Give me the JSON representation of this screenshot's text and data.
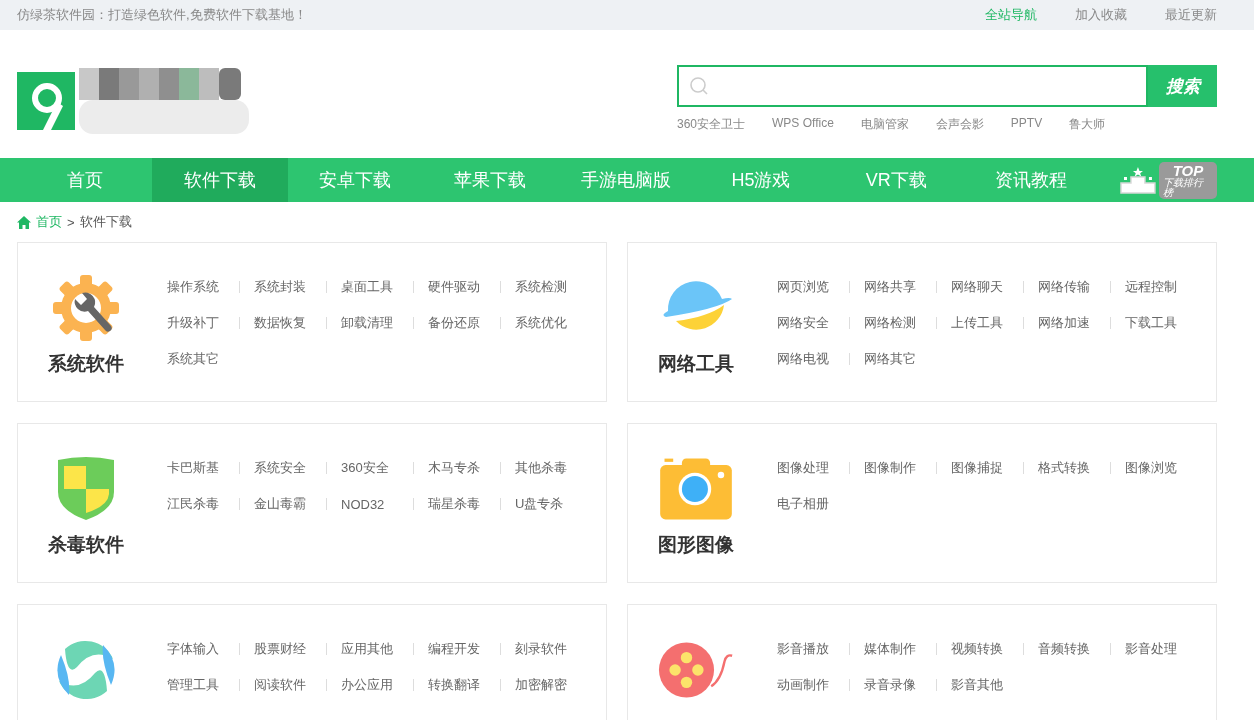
{
  "top_bar": {
    "slogan": "仿绿茶软件园：打造绿色软件,免费软件下载基地！",
    "links": [
      {
        "label": "全站导航",
        "highlighted": true
      },
      {
        "label": "加入收藏",
        "highlighted": false
      },
      {
        "label": "最近更新",
        "highlighted": false
      }
    ]
  },
  "search": {
    "button": "搜索",
    "hot_keywords": [
      "360安全卫士",
      "WPS Office",
      "电脑管家",
      "会声会影",
      "PPTV",
      "鲁大师"
    ]
  },
  "nav": {
    "items": [
      {
        "label": "首页",
        "selected": false
      },
      {
        "label": "软件下载",
        "selected": true
      },
      {
        "label": "安卓下载",
        "selected": false
      },
      {
        "label": "苹果下载",
        "selected": false
      },
      {
        "label": "手游电脑版",
        "selected": false
      },
      {
        "label": "H5游戏",
        "selected": false
      },
      {
        "label": "VR下载",
        "selected": false
      },
      {
        "label": "资讯教程",
        "selected": false
      }
    ],
    "ranking_badge": {
      "title": "TOP",
      "subtitle": "下载排行榜"
    }
  },
  "breadcrumb": {
    "home": "首页",
    "separator": ">",
    "current": "软件下载"
  },
  "categories": [
    {
      "title": "系统软件",
      "kind": "gear",
      "links": [
        "操作系统",
        "系统封装",
        "桌面工具",
        "硬件驱动",
        "系统检测",
        "升级补丁",
        "数据恢复",
        "卸载清理",
        "备份还原",
        "系统优化",
        "系统其它"
      ]
    },
    {
      "title": "网络工具",
      "kind": "planet",
      "links": [
        "网页浏览",
        "网络共享",
        "网络聊天",
        "网络传输",
        "远程控制",
        "网络安全",
        "网络检测",
        "上传工具",
        "网络加速",
        "下载工具",
        "网络电视",
        "网络其它"
      ]
    },
    {
      "title": "杀毒软件",
      "kind": "shield",
      "links": [
        "卡巴斯基",
        "系统安全",
        "360安全",
        "木马专杀",
        "其他杀毒",
        "江民杀毒",
        "金山毒霸",
        "NOD32",
        "瑞星杀毒",
        "U盘专杀"
      ]
    },
    {
      "title": "图形图像",
      "kind": "camera",
      "links": [
        "图像处理",
        "图像制作",
        "图像捕捉",
        "格式转换",
        "图像浏览",
        "电子相册"
      ]
    },
    {
      "kind": "swirl",
      "links": [
        "字体输入",
        "股票财经",
        "应用其他",
        "编程开发",
        "刻录软件",
        "管理工具",
        "阅读软件",
        "办公应用",
        "转换翻译",
        "加密解密"
      ]
    },
    {
      "kind": "reel",
      "links": [
        "影音播放",
        "媒体制作",
        "视频转换",
        "音频转换",
        "影音处理",
        "动画制作",
        "录音录像",
        "影音其他"
      ]
    }
  ]
}
